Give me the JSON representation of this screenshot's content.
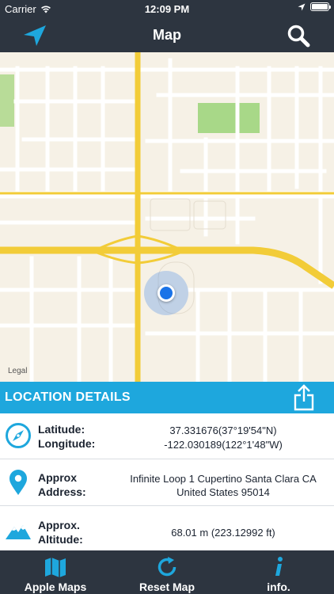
{
  "status_bar": {
    "carrier": "Carrier",
    "time": "12:09 PM"
  },
  "nav": {
    "title": "Map",
    "left_icon": "location-arrow-icon",
    "right_icon": "search-icon"
  },
  "map": {
    "legal": "Legal"
  },
  "details": {
    "header": "LOCATION DETAILS",
    "share_icon": "share-icon",
    "coordinates": {
      "label_1": "Latitude:",
      "label_2": "Longitude:",
      "value_1": "37.331676(37°19'54\"N)",
      "value_2": "-122.030189(122°1'48\"W)"
    },
    "address": {
      "label_1": "Approx",
      "label_2": "Address:",
      "value_1": "Infinite Loop 1 Cupertino  Santa Clara CA",
      "value_2": "United States 95014"
    },
    "altitude": {
      "label_1": "Approx.",
      "label_2": "Altitude:",
      "value": "68.01 m (223.12992 ft)"
    }
  },
  "tabs": [
    {
      "label": "Apple Maps",
      "icon": "map-icon"
    },
    {
      "label": "Reset Map",
      "icon": "refresh-icon"
    },
    {
      "label": "info.",
      "icon": "info-icon"
    }
  ],
  "colors": {
    "bar": "#2d3540",
    "accent": "#1ea7dd",
    "highway": "#f2cc38",
    "map_bg": "#f6f1e6",
    "user_dot": "#1a73e8"
  }
}
